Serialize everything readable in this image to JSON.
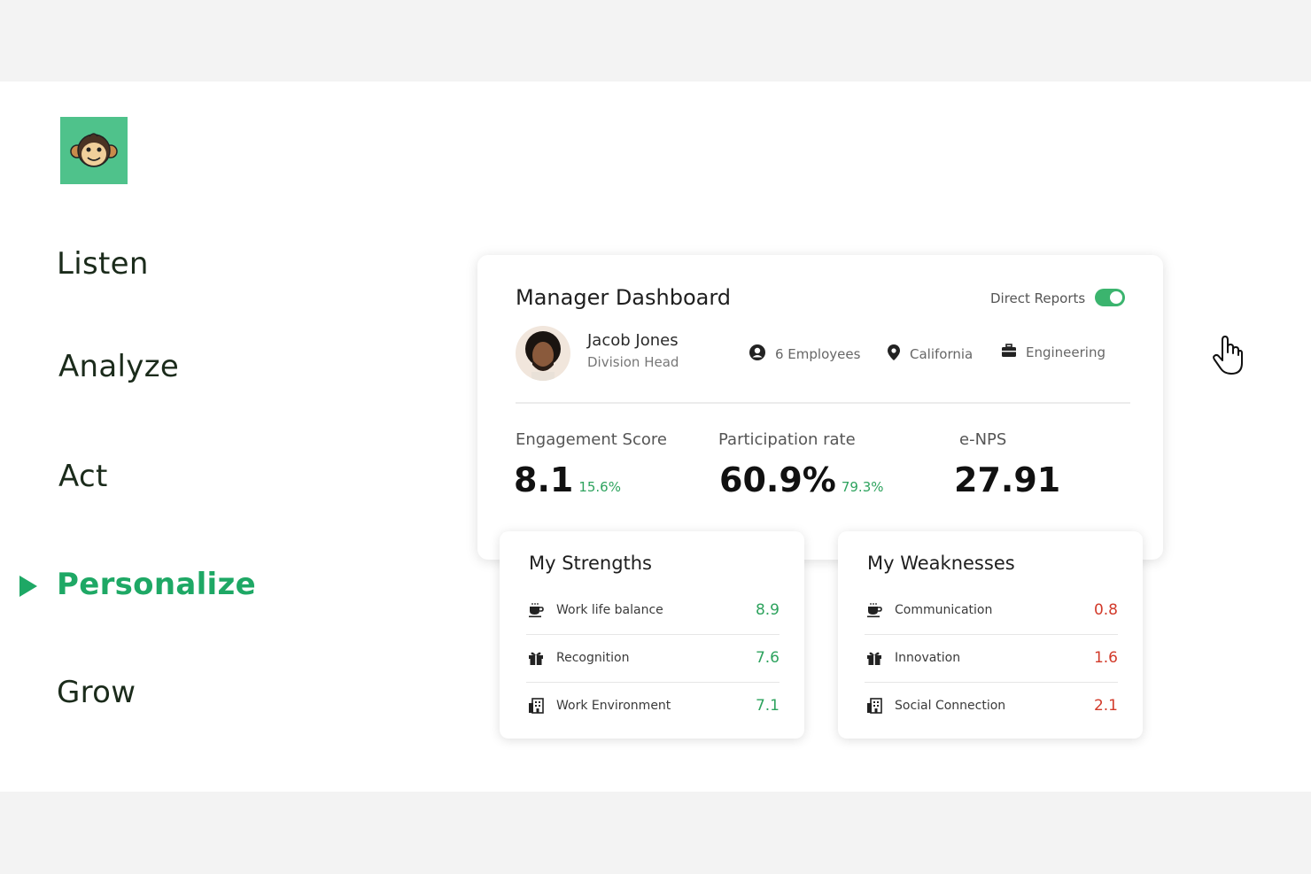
{
  "nav": {
    "items": [
      {
        "label": "Listen"
      },
      {
        "label": "Analyze"
      },
      {
        "label": "Act"
      },
      {
        "label": "Personalize"
      },
      {
        "label": "Grow"
      }
    ],
    "active_index": 3
  },
  "dashboard": {
    "title": "Manager Dashboard",
    "toggle_label": "Direct Reports",
    "toggle_on": true,
    "person": {
      "name": "Jacob Jones",
      "role": "Division Head"
    },
    "meta": {
      "employees": "6 Employees",
      "location": "California",
      "department": "Engineering"
    },
    "stats": [
      {
        "label": "Engagement Score",
        "value": "8.1",
        "delta": "15.6%"
      },
      {
        "label": "Participation rate",
        "value": "60.9%",
        "delta": "79.3%"
      },
      {
        "label": "e-NPS",
        "value": "27.91",
        "delta": ""
      }
    ]
  },
  "strengths": {
    "title": "My Strengths",
    "items": [
      {
        "icon": "coffee-icon",
        "label": "Work life balance",
        "value": "8.9"
      },
      {
        "icon": "gift-icon",
        "label": "Recognition",
        "value": "7.6"
      },
      {
        "icon": "building-icon",
        "label": "Work Environment",
        "value": "7.1"
      }
    ]
  },
  "weaknesses": {
    "title": "My Weaknesses",
    "items": [
      {
        "icon": "coffee-icon",
        "label": "Communication",
        "value": "0.8"
      },
      {
        "icon": "gift-icon",
        "label": "Innovation",
        "value": "1.6"
      },
      {
        "icon": "building-icon",
        "label": "Social Connection",
        "value": "2.1"
      }
    ]
  },
  "colors": {
    "brand": "#4fc28b",
    "active": "#1ea865",
    "positive": "#2ea35e",
    "negative": "#d23a2a"
  }
}
